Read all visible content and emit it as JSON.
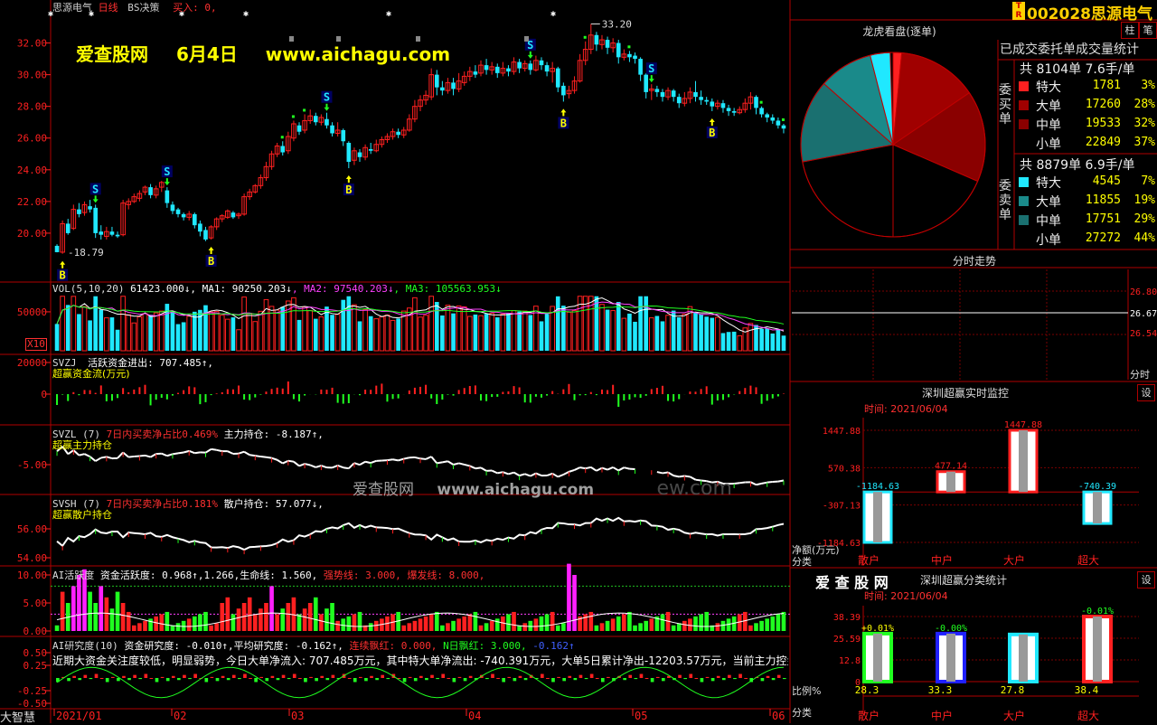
{
  "colors": {
    "up": "#ff2020",
    "down": "#20e8ff",
    "frame": "#b00000",
    "yellow": "#ffff00",
    "green": "#20ff20",
    "magenta": "#ff20ff",
    "white": "#ffffff",
    "darkred": "#a00000",
    "teal": "#1a8a8a"
  },
  "header": {
    "stock_name": "思源电气",
    "line_type": "日线",
    "indicator": "BS决策",
    "buy_text": "买入: 0,",
    "stock_code": "002028",
    "stock_name_right": "思源电气",
    "btn1": "柱",
    "btn2": "笔",
    "badge_top": "T",
    "badge_bottom": "R"
  },
  "watermark": {
    "site": "爱查股网",
    "date": "6月4日",
    "url": "www.aichagu.com",
    "center_text": "爱查股网",
    "center_url": "www.aichagu.com",
    "faint": "ew.com"
  },
  "price_chart": {
    "y_ticks": [
      "32.00",
      "30.00",
      "28.00",
      "26.00",
      "24.00",
      "22.00",
      "20.00"
    ],
    "y_vals": [
      32,
      30,
      28,
      26,
      24,
      22,
      20
    ],
    "ymin": 17.6,
    "ymax": 33.8,
    "high_label": "33.20",
    "low_label": "18.79",
    "candles": [
      [
        19.2,
        18.8,
        18.79,
        19.3
      ],
      [
        18.8,
        20.6,
        18.7,
        20.8
      ],
      [
        20.6,
        20.0,
        19.9,
        20.9
      ],
      [
        20.3,
        21.5,
        20.2,
        21.8
      ],
      [
        21.5,
        21.2,
        21.0,
        21.9
      ],
      [
        21.3,
        21.8,
        21.1,
        22.0
      ],
      [
        21.7,
        21.5,
        21.3,
        22.1
      ],
      [
        21.6,
        20.0,
        19.7,
        21.8
      ],
      [
        20.1,
        19.9,
        19.6,
        20.5
      ],
      [
        19.8,
        20.1,
        19.6,
        20.4
      ],
      [
        20.1,
        19.9,
        19.8,
        20.4
      ],
      [
        19.9,
        19.8,
        19.7,
        20.1
      ],
      [
        19.9,
        21.9,
        19.8,
        22.1
      ],
      [
        21.8,
        22.0,
        21.5,
        22.2
      ],
      [
        22.0,
        22.3,
        21.9,
        22.5
      ],
      [
        22.2,
        22.5,
        22.0,
        22.7
      ],
      [
        22.6,
        22.9,
        22.4,
        23.0
      ],
      [
        22.9,
        22.4,
        22.2,
        23.1
      ],
      [
        22.4,
        22.8,
        22.2,
        23.0
      ],
      [
        22.9,
        23.2,
        22.6,
        23.3
      ],
      [
        22.7,
        21.9,
        21.6,
        22.9
      ],
      [
        21.8,
        21.4,
        21.2,
        22.0
      ],
      [
        21.5,
        21.2,
        21.0,
        21.6
      ],
      [
        21.2,
        21.0,
        20.8,
        21.3
      ],
      [
        21.0,
        21.2,
        20.8,
        21.4
      ],
      [
        21.2,
        20.5,
        20.3,
        21.3
      ],
      [
        20.6,
        20.1,
        19.8,
        20.8
      ],
      [
        20.2,
        19.6,
        19.5,
        20.4
      ],
      [
        19.7,
        20.4,
        19.6,
        20.5
      ],
      [
        20.4,
        20.9,
        20.2,
        21.0
      ],
      [
        20.9,
        21.1,
        20.7,
        21.2
      ],
      [
        21.0,
        21.4,
        20.9,
        21.5
      ],
      [
        21.3,
        21.0,
        20.9,
        21.4
      ],
      [
        21.1,
        21.2,
        20.9,
        21.3
      ],
      [
        21.2,
        22.3,
        21.1,
        22.5
      ],
      [
        22.3,
        22.6,
        22.1,
        22.8
      ],
      [
        22.6,
        23.0,
        22.5,
        23.1
      ],
      [
        23.0,
        23.5,
        22.8,
        23.7
      ],
      [
        23.5,
        24.2,
        23.3,
        24.5
      ],
      [
        24.2,
        25.0,
        24.0,
        25.2
      ],
      [
        25.0,
        25.5,
        24.8,
        25.7
      ],
      [
        25.5,
        25.1,
        24.9,
        25.8
      ],
      [
        25.2,
        26.1,
        25.0,
        26.4
      ],
      [
        26.0,
        26.9,
        25.8,
        27.1
      ],
      [
        26.8,
        26.4,
        26.2,
        27.0
      ],
      [
        26.5,
        27.1,
        26.3,
        27.5
      ],
      [
        27.1,
        27.4,
        26.9,
        27.8
      ],
      [
        27.4,
        27.0,
        26.8,
        27.6
      ],
      [
        27.0,
        27.3,
        26.8,
        27.5
      ],
      [
        27.2,
        26.8,
        26.6,
        27.6
      ],
      [
        26.8,
        26.3,
        26.1,
        27.0
      ],
      [
        26.3,
        26.5,
        26.1,
        27.0
      ],
      [
        26.5,
        25.8,
        25.5,
        26.6
      ],
      [
        25.7,
        24.5,
        24.1,
        25.8
      ],
      [
        24.6,
        25.2,
        24.3,
        25.4
      ],
      [
        25.1,
        24.8,
        24.5,
        25.3
      ],
      [
        24.8,
        25.4,
        24.6,
        25.6
      ],
      [
        25.3,
        25.2,
        25.0,
        25.7
      ],
      [
        25.2,
        25.6,
        25.1,
        25.9
      ],
      [
        25.6,
        25.9,
        25.4,
        26.1
      ],
      [
        25.9,
        26.1,
        25.7,
        26.3
      ],
      [
        26.1,
        26.4,
        25.9,
        26.6
      ],
      [
        26.4,
        26.2,
        26.0,
        26.6
      ],
      [
        26.2,
        26.5,
        26.0,
        26.7
      ],
      [
        26.5,
        27.2,
        26.4,
        27.5
      ],
      [
        27.2,
        28.0,
        27.0,
        28.4
      ],
      [
        28.0,
        28.4,
        27.7,
        28.7
      ],
      [
        28.4,
        28.7,
        28.1,
        29.0
      ],
      [
        28.6,
        30.0,
        28.4,
        30.4
      ],
      [
        30.0,
        29.2,
        28.7,
        30.3
      ],
      [
        29.2,
        29.0,
        28.7,
        29.6
      ],
      [
        29.0,
        29.5,
        28.8,
        29.8
      ],
      [
        29.5,
        29.1,
        28.7,
        29.8
      ],
      [
        29.1,
        29.6,
        28.9,
        30.1
      ],
      [
        29.5,
        29.9,
        29.3,
        30.2
      ],
      [
        29.9,
        30.2,
        29.6,
        30.5
      ],
      [
        30.2,
        30.0,
        29.8,
        30.6
      ],
      [
        30.1,
        30.6,
        29.9,
        30.9
      ],
      [
        30.6,
        30.3,
        30.0,
        31.0
      ],
      [
        30.3,
        30.5,
        30.0,
        30.8
      ],
      [
        30.5,
        30.1,
        29.8,
        30.7
      ],
      [
        30.1,
        30.4,
        29.9,
        30.8
      ],
      [
        30.4,
        30.2,
        29.9,
        30.6
      ],
      [
        30.2,
        30.8,
        30.0,
        31.1
      ],
      [
        30.8,
        30.4,
        30.1,
        31.0
      ],
      [
        30.4,
        30.7,
        30.2,
        30.9
      ],
      [
        30.7,
        30.3,
        30.0,
        30.9
      ],
      [
        30.3,
        30.9,
        30.2,
        31.2
      ],
      [
        30.9,
        30.6,
        30.3,
        31.1
      ],
      [
        30.6,
        30.2,
        29.9,
        30.8
      ],
      [
        30.2,
        30.4,
        29.5,
        30.8
      ],
      [
        30.4,
        29.2,
        28.9,
        30.5
      ],
      [
        29.3,
        28.7,
        28.3,
        29.5
      ],
      [
        28.8,
        29.0,
        28.5,
        29.3
      ],
      [
        29.0,
        29.6,
        28.8,
        29.9
      ],
      [
        29.6,
        30.9,
        29.5,
        31.3
      ],
      [
        30.9,
        31.6,
        30.6,
        32.1
      ],
      [
        31.6,
        32.5,
        31.3,
        33.2
      ],
      [
        32.5,
        31.9,
        31.5,
        32.7
      ],
      [
        31.9,
        32.2,
        31.6,
        32.5
      ],
      [
        32.2,
        31.7,
        31.3,
        32.4
      ],
      [
        31.7,
        32.0,
        31.4,
        32.3
      ],
      [
        32.0,
        31.1,
        30.7,
        32.2
      ],
      [
        31.1,
        31.3,
        30.9,
        31.6
      ],
      [
        31.3,
        31.1,
        30.8,
        31.5
      ],
      [
        31.2,
        31.0,
        30.7,
        31.4
      ],
      [
        31.0,
        30.0,
        29.6,
        31.1
      ],
      [
        30.0,
        28.9,
        28.5,
        30.1
      ],
      [
        29.0,
        29.1,
        28.4,
        29.4
      ],
      [
        29.1,
        28.9,
        28.6,
        29.3
      ],
      [
        28.9,
        28.6,
        28.3,
        29.1
      ],
      [
        28.6,
        29.0,
        28.4,
        29.2
      ],
      [
        29.0,
        28.6,
        28.3,
        29.1
      ],
      [
        28.6,
        28.2,
        27.9,
        28.8
      ],
      [
        28.2,
        28.5,
        28.0,
        28.9
      ],
      [
        28.5,
        28.9,
        28.2,
        29.2
      ],
      [
        28.9,
        28.6,
        28.3,
        29.6
      ],
      [
        28.6,
        28.4,
        28.1,
        29.0
      ],
      [
        28.4,
        28.3,
        28.1,
        28.6
      ],
      [
        28.3,
        28.0,
        27.7,
        28.5
      ],
      [
        28.0,
        28.2,
        27.8,
        28.4
      ],
      [
        28.2,
        27.9,
        27.6,
        28.4
      ],
      [
        27.9,
        27.7,
        27.4,
        28.1
      ],
      [
        27.7,
        27.6,
        27.4,
        27.9
      ],
      [
        27.6,
        27.8,
        27.5,
        28.0
      ],
      [
        27.8,
        28.2,
        27.6,
        28.5
      ],
      [
        28.2,
        28.6,
        27.8,
        28.9
      ],
      [
        28.6,
        27.9,
        27.5,
        28.7
      ],
      [
        27.9,
        27.5,
        27.3,
        28.0
      ],
      [
        27.5,
        27.3,
        27.0,
        27.6
      ],
      [
        27.3,
        27.1,
        26.9,
        27.5
      ],
      [
        27.1,
        26.8,
        26.6,
        27.3
      ],
      [
        26.8,
        26.6,
        26.3,
        26.9
      ]
    ],
    "buy_signals": [
      1,
      28,
      53,
      92,
      119
    ],
    "sell_signals": [
      7,
      20,
      49,
      86,
      108
    ],
    "asterisk_x": [
      56,
      101,
      201,
      272,
      430,
      612
    ],
    "gray_marks_x": [
      320,
      372,
      460,
      580
    ]
  },
  "volume_panel": {
    "label": "VOL(5,10,20)",
    "vol": "61423.000↓",
    "ma1": ", MA1: 90250.203↓",
    "ma2": ", MA2: 97540.203↓",
    "ma3": ", MA3: 105563.953↓",
    "y_label": "50000",
    "unit": "X10",
    "ymax": 72000
  },
  "svzj_panel": {
    "name": "SVZJ",
    "title": "活跃资金进出:",
    "value": "707.485↑,",
    "sub": "超赢资金流(万元)",
    "y_top": "20000",
    "y_zero": "0"
  },
  "svzl_panel": {
    "name": "SVZL (7)",
    "pct_label": "7日内买卖净占比0.469%",
    "hold": "主力持仓: -8.187↑,",
    "sub": "超赢主力持仓",
    "y_label": "-5.00"
  },
  "svsh_panel": {
    "name": "SVSH (7)",
    "pct_label": "7日内买卖净占比0.181%",
    "hold": "散户持仓: 57.077↓,",
    "sub": "超赢散户持仓",
    "y1": "56.00",
    "y2": "54.00"
  },
  "ai_active": {
    "title": "AI活跃度",
    "vals": "资金活跃度: 0.968↑,1.266,生命线: 1.560,",
    "strong": "强势线: 3.000,",
    "burst": "爆发线: 8.000,",
    "y1": "10.00",
    "y2": "5.00",
    "y3": "0.00"
  },
  "ai_research": {
    "title": "AI研究度(10)",
    "vals": "资金研究度: -0.010↑,平均研究度: -0.162↑,",
    "lianxu": "连续飘红: 0.000,",
    "nday": "N日飘红: 3.000,",
    "last": "-0.162↑",
    "comment": "近期大资金关注度较低，明显弱势，今日大单净流入: 707.485万元，其中特大单净流出: -740.391万元，大单5日累计净出-12203.57万元，当前主力控盘弱",
    "y1": "0.50",
    "y2": "0.25",
    "y3": "-0.25",
    "y4": "-0.50"
  },
  "x_axis": {
    "left": "大智慧",
    "labels": [
      "2021/01",
      "02",
      "03",
      "04",
      "05",
      "06"
    ]
  },
  "longhu": {
    "title": "龙虎看盘(逐单)",
    "subtitle": "已成交委托单成交量统计",
    "buy_side": "委买单",
    "sell_side": "委卖单",
    "buy_total": "共 8104单 7.6手/单",
    "sell_total": "共 8879单 6.9手/单",
    "buy_rows": [
      [
        "特大",
        "1781",
        "3%"
      ],
      [
        "大单",
        "17260",
        "28%"
      ],
      [
        "中单",
        "19533",
        "32%"
      ],
      [
        "小单",
        "22849",
        "37%"
      ]
    ],
    "sell_rows": [
      [
        "特大",
        "4545",
        "7%"
      ],
      [
        "大单",
        "11855",
        "19%"
      ],
      [
        "中单",
        "17751",
        "29%"
      ],
      [
        "小单",
        "27272",
        "44%"
      ]
    ],
    "pie_buy_pct": [
      3,
      28,
      32,
      37
    ],
    "pie_sell_pct": [
      7,
      19,
      29,
      44
    ]
  },
  "fenshi": {
    "title": "分时走势",
    "p1": "26.80",
    "p2": "26.67",
    "p3": "26.54",
    "label": "分时"
  },
  "monitor": {
    "title": "深圳超赢实时监控",
    "set": "设",
    "time": "时间: 2021/06/04",
    "y_ticks": [
      "1447.88",
      "570.38",
      "-307.13",
      "-1184.63"
    ],
    "ymin": -1184.63,
    "ymax": 1447.88,
    "bars": [
      {
        "cat": "散户",
        "value": -1184.63,
        "label": "-1184.63"
      },
      {
        "cat": "中户",
        "value": 477.14,
        "label": "477.14"
      },
      {
        "cat": "大户",
        "value": 1447.88,
        "label": "1447.88"
      },
      {
        "cat": "超大",
        "value": -740.39,
        "label": "-740.39"
      }
    ],
    "unit": "净额(万元)",
    "class": "分类"
  },
  "classify": {
    "brand": "爱 查 股 网",
    "title": "深圳超赢分类统计",
    "set": "设",
    "time": "时间: 2021/06/04",
    "y_ticks": [
      "38.39",
      "25.59",
      "12.8",
      "0"
    ],
    "ymax": 38.39,
    "bars": [
      {
        "cat": "散户",
        "value": 28.3,
        "label": "28.3",
        "delta": "+0.01%",
        "color": "#20ff20"
      },
      {
        "cat": "中户",
        "value": 28.3,
        "label": "33.3",
        "delta": "-0.00%",
        "color": "#2020ff"
      },
      {
        "cat": "大户",
        "value": 27.8,
        "label": "27.8",
        "delta": "",
        "color": "#20e8ff"
      },
      {
        "cat": "超大",
        "value": 38.4,
        "label": "38.4",
        "delta": "-0.01%",
        "color": "#ff2020"
      }
    ],
    "unit": "比例%",
    "class": "分类"
  }
}
